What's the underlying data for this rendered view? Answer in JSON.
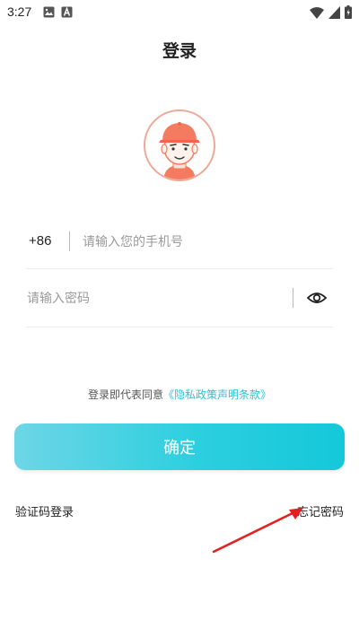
{
  "status_bar": {
    "time": "3:27",
    "icons_left": [
      "image-icon",
      "a-letter-icon"
    ],
    "icons_right": [
      "wifi-icon",
      "signal-icon",
      "battery-icon"
    ]
  },
  "header": {
    "title": "登录"
  },
  "avatar": {
    "icon": "avatar-cartoon-icon"
  },
  "phone": {
    "country_code": "+86",
    "placeholder": "请输入您的手机号",
    "value": ""
  },
  "password": {
    "placeholder": "请输入密码",
    "value": "",
    "toggle_icon": "eye-icon"
  },
  "agreement": {
    "prefix": "登录即代表同意",
    "link": "《隐私政策声明条款》"
  },
  "confirm_button": {
    "label": "确定"
  },
  "footer": {
    "left_link": "验证码登录",
    "right_link": "忘记密码"
  },
  "colors": {
    "accent": "#2cc0d4",
    "button_start": "#6dd6e6",
    "button_end": "#14c8da",
    "avatar_border": "#f0a896",
    "annotation_arrow": "#e41f1f"
  }
}
